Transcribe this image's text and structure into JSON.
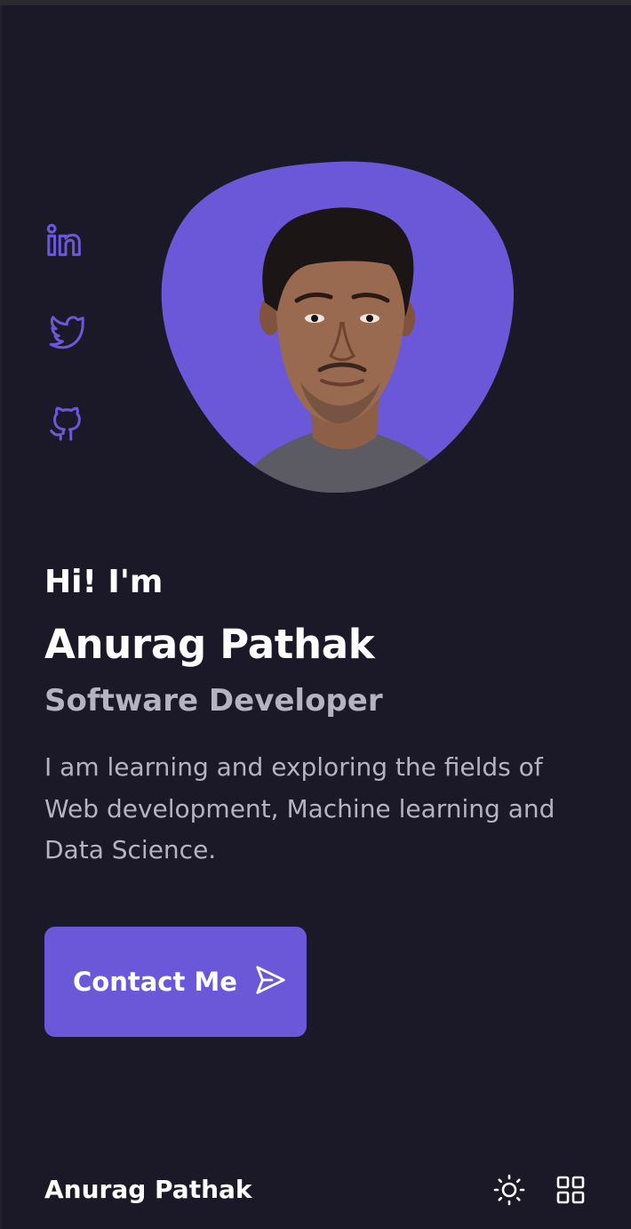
{
  "social": {
    "links": [
      {
        "icon": "linkedin-icon"
      },
      {
        "icon": "twitter-icon"
      },
      {
        "icon": "github-icon"
      }
    ]
  },
  "hero": {
    "greeting": "Hi! I'm",
    "name": "Anurag Pathak",
    "role": "Software Developer",
    "description": "I am learning and exploring the fields of Web development, Machine learning and Data Science.",
    "contact_label": "Contact Me",
    "photo_icon": "profile-photo"
  },
  "footer": {
    "brand": "Anurag Pathak",
    "theme_icon": "sun-icon",
    "menu_icon": "grid-menu-icon"
  },
  "colors": {
    "background": "#1b1928",
    "accent": "#6b58d8",
    "text_primary": "#ffffff",
    "text_secondary": "#b5b3c2"
  }
}
